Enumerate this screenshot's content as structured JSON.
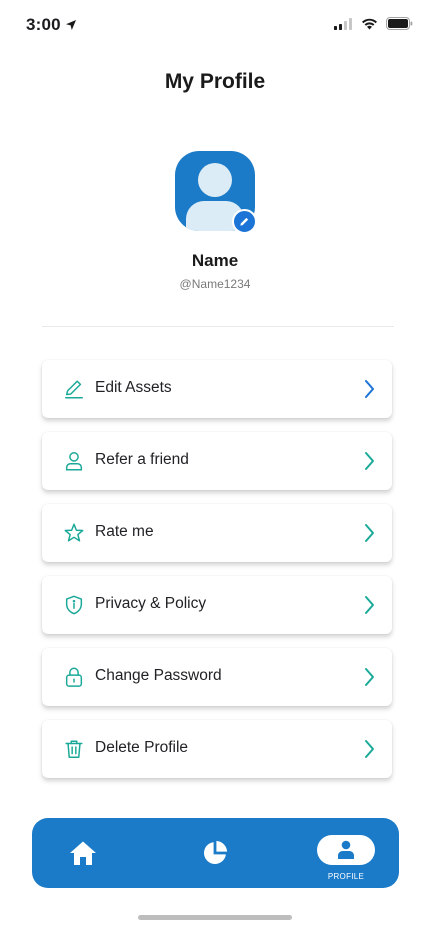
{
  "status_bar": {
    "time": "3:00",
    "icons": [
      "location-arrow-icon",
      "signal-icon",
      "wifi-icon",
      "battery-icon"
    ]
  },
  "header": {
    "title": "My Profile"
  },
  "profile": {
    "name": "Name",
    "handle": "@Name1234",
    "avatar_color": "#1b7bc8",
    "edit_badge_icon": "pencil-icon"
  },
  "menu": {
    "accent_color": "#1aa998",
    "items": [
      {
        "label": "Edit Assets",
        "icon": "edit-icon",
        "chevron_color": "#1b74d6"
      },
      {
        "label": "Refer a friend",
        "icon": "user-icon",
        "chevron_color": "#1aa998"
      },
      {
        "label": "Rate me",
        "icon": "star-icon",
        "chevron_color": "#1aa998"
      },
      {
        "label": "Privacy & Policy",
        "icon": "shield-icon",
        "chevron_color": "#1aa998"
      },
      {
        "label": "Change Password",
        "icon": "lock-icon",
        "chevron_color": "#1aa998"
      },
      {
        "label": "Delete Profile",
        "icon": "trash-icon",
        "chevron_color": "#1aa998"
      }
    ]
  },
  "bottom_nav": {
    "background": "#1b7bc8",
    "items": [
      {
        "icon": "home-icon",
        "label": "",
        "active": false
      },
      {
        "icon": "pie-chart-icon",
        "label": "",
        "active": false
      },
      {
        "icon": "profile-icon",
        "label": "PROFILE",
        "active": true
      }
    ]
  }
}
